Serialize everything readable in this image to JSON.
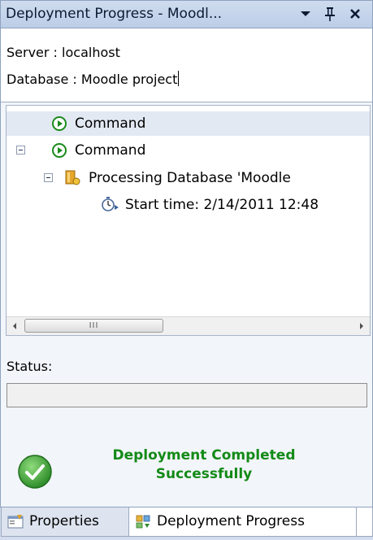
{
  "window": {
    "title": "Deployment Progress - Moodl...",
    "dropdown_icon": "chevron-down-icon",
    "pin_icon": "pin-icon",
    "close_icon": "close-icon"
  },
  "header": {
    "server_line": "Server :  localhost",
    "database_line": "Database : Moodle project"
  },
  "tree": {
    "rows": [
      {
        "label": "Command",
        "icon": "play-circle-icon",
        "selected": true
      },
      {
        "label": "Command",
        "icon": "play-circle-icon",
        "expanded": true
      },
      {
        "label": "Processing Database 'Moodle",
        "icon": "database-folder-icon",
        "expanded": true
      },
      {
        "label": "Start time: 2/14/2011 12:48",
        "icon": "timer-icon"
      }
    ],
    "scroll_thumb_grip": "III"
  },
  "status": {
    "label": "Status:",
    "value": ""
  },
  "result": {
    "line1": "Deployment Completed",
    "line2": "Successfully",
    "icon": "success-check-icon",
    "color": "#138a17"
  },
  "tabs": [
    {
      "label": "Properties",
      "icon": "properties-icon",
      "active": false
    },
    {
      "label": "Deployment Progress",
      "icon": "deployment-icon",
      "active": true
    }
  ]
}
